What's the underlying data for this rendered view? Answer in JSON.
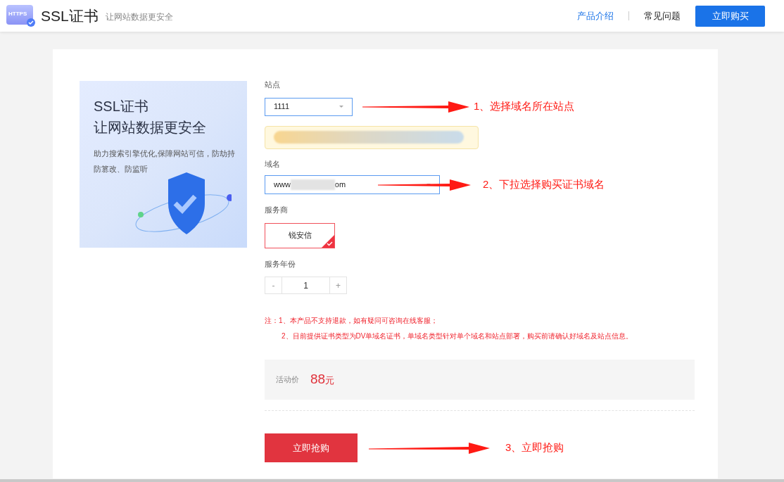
{
  "header": {
    "logo_badge": "HTTPS",
    "title": "SSL证书",
    "subtitle": "让网站数据更安全",
    "nav": [
      {
        "label": "产品介绍",
        "selected": true
      },
      {
        "label": "常见问题",
        "selected": false
      }
    ],
    "buy_button": "立即购买"
  },
  "banner": {
    "title": "SSL证书",
    "headline": "让网站数据更安全",
    "description": "助力搜索引擎优化,保障网站可信，防劫持防篡改、防监听"
  },
  "form": {
    "site": {
      "label": "站点",
      "value": "1111"
    },
    "domain": {
      "label": "域名",
      "value_start": "www",
      "value_end": "om"
    },
    "provider": {
      "label": "服务商",
      "options": [
        {
          "label": "锐安信",
          "selected": true
        }
      ]
    },
    "years": {
      "label": "服务年份",
      "minus": "-",
      "value": "1",
      "plus": "+"
    },
    "notes": [
      "注：1、本产品不支持退款，如有疑问可咨询在线客服；",
      "2、目前提供证书类型为DV单域名证书，单域名类型针对单个域名和站点部署，购买前请确认好域名及站点信息。"
    ],
    "price": {
      "label": "活动价",
      "amount": "88",
      "unit": "元"
    },
    "submit": "立即抢购"
  },
  "annotations": [
    "1、选择域名所在站点",
    "2、下拉选择购买证书域名",
    "3、立即抢购"
  ]
}
